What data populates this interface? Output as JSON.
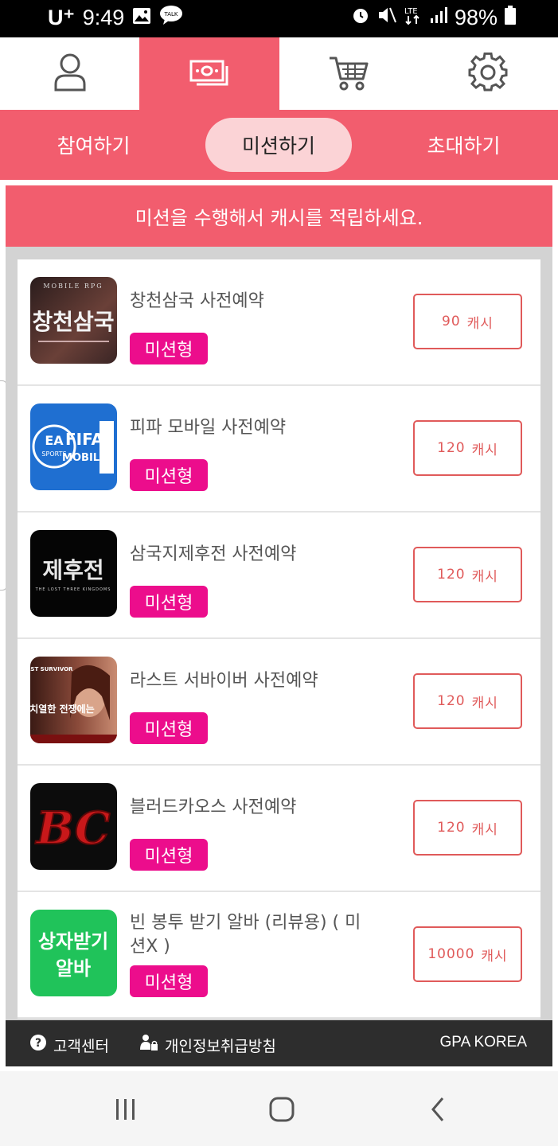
{
  "status": {
    "carrier": "U⁺",
    "time": "9:49",
    "battery": "98%",
    "icons": [
      "image-icon",
      "talk-icon",
      "alarm-icon",
      "mute-icon",
      "lte-icon",
      "signal-icon",
      "battery-icon"
    ]
  },
  "top_tabs": [
    {
      "icon": "user-icon",
      "active": false
    },
    {
      "icon": "money-icon",
      "active": true
    },
    {
      "icon": "cart-icon",
      "active": false
    },
    {
      "icon": "gear-icon",
      "active": false
    }
  ],
  "sub_tabs": {
    "join": "참여하기",
    "mission": "미션하기",
    "invite": "초대하기"
  },
  "banner": "미션을 수행해서 캐시를 적립하세요.",
  "missions": [
    {
      "title": "창천삼국 사전예약",
      "badge": "미션형",
      "cash": "90",
      "unit": "캐시",
      "thumb_text": "창천삼국",
      "thumb_sub": "MOBILE RPG"
    },
    {
      "title": "피파 모바일 사전예약",
      "badge": "미션형",
      "cash": "120",
      "unit": "캐시",
      "thumb_text": "FIFA",
      "thumb_sub": "MOBILE"
    },
    {
      "title": "삼국지제후전 사전예약",
      "badge": "미션형",
      "cash": "120",
      "unit": "캐시",
      "thumb_text": "제후전",
      "thumb_sub": "THE LOST THREE KINGDOMS"
    },
    {
      "title": "라스트 서바이버 사전예약",
      "badge": "미션형",
      "cash": "120",
      "unit": "캐시",
      "thumb_text": "LAST SURVIVOR",
      "thumb_sub": "치열한 전쟁에는"
    },
    {
      "title": "블러드카오스 사전예약",
      "badge": "미션형",
      "cash": "120",
      "unit": "캐시",
      "thumb_text": "BC",
      "thumb_sub": ""
    },
    {
      "title": "빈 봉투 받기 알바 (리뷰용) ( 미션X )",
      "badge": "미션형",
      "cash": "10000",
      "unit": "캐시",
      "thumb_text": "상자받기",
      "thumb_sub": "알바"
    }
  ],
  "footer": {
    "help": "고객센터",
    "privacy": "개인정보취급방침",
    "brand": "GPA KOREA"
  },
  "colors": {
    "accent": "#f25d6e",
    "badge": "#ec0d8c",
    "cash_border": "#e05a5a",
    "footer": "#2d2d2d"
  }
}
